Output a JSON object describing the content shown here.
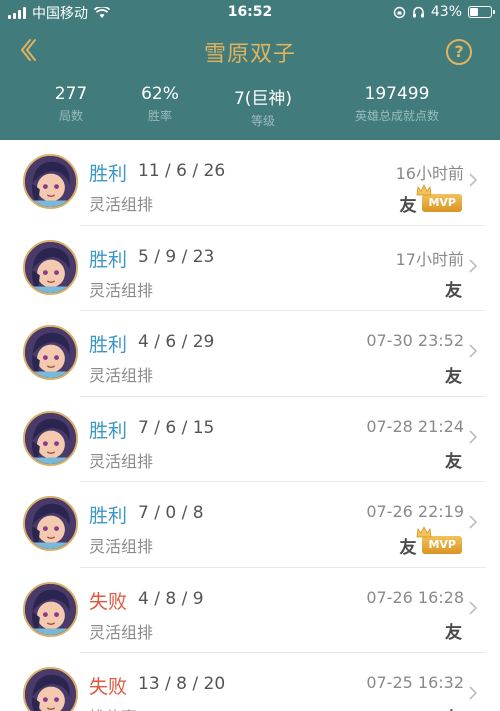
{
  "status_bar": {
    "carrier": "中国移动",
    "time": "16:52",
    "battery": "43%",
    "battery_level": 0.43
  },
  "nav": {
    "title": "雪原双子"
  },
  "stats": [
    {
      "value": "277",
      "label": "局数"
    },
    {
      "value": "62%",
      "label": "胜率"
    },
    {
      "value": "7(巨神)",
      "label": "等级"
    },
    {
      "value": "197499",
      "label": "英雄总成就点数"
    }
  ],
  "matches": [
    {
      "result": "胜利",
      "outcome": "win",
      "kda": "11 / 6 / 26",
      "mode": "灵活组排",
      "time": "16小时前",
      "friend": "友",
      "mvp": "MVP",
      "has_mvp": true
    },
    {
      "result": "胜利",
      "outcome": "win",
      "kda": "5 / 9 / 23",
      "mode": "灵活组排",
      "time": "17小时前",
      "friend": "友",
      "mvp": "",
      "has_mvp": false
    },
    {
      "result": "胜利",
      "outcome": "win",
      "kda": "4 / 6 / 29",
      "mode": "灵活组排",
      "time": "07-30 23:52",
      "friend": "友",
      "mvp": "",
      "has_mvp": false
    },
    {
      "result": "胜利",
      "outcome": "win",
      "kda": "7 / 6 / 15",
      "mode": "灵活组排",
      "time": "07-28 21:24",
      "friend": "友",
      "mvp": "",
      "has_mvp": false
    },
    {
      "result": "胜利",
      "outcome": "win",
      "kda": "7 / 0 / 8",
      "mode": "灵活组排",
      "time": "07-26 22:19",
      "friend": "友",
      "mvp": "MVP",
      "has_mvp": true
    },
    {
      "result": "失败",
      "outcome": "loss",
      "kda": "4 / 8 / 9",
      "mode": "灵活组排",
      "time": "07-26 16:28",
      "friend": "友",
      "mvp": "",
      "has_mvp": false
    },
    {
      "result": "失败",
      "outcome": "loss",
      "kda": "13 / 8 / 20",
      "mode": "排位赛",
      "time": "07-25 16:32",
      "friend": "友",
      "mvp": "",
      "has_mvp": false
    }
  ],
  "colors": {
    "header_bg": "#417b7c",
    "title_gold": "#e0b35e",
    "win": "#3b97c4",
    "loss": "#e0573f",
    "mvp_gold": "#e0a735"
  }
}
